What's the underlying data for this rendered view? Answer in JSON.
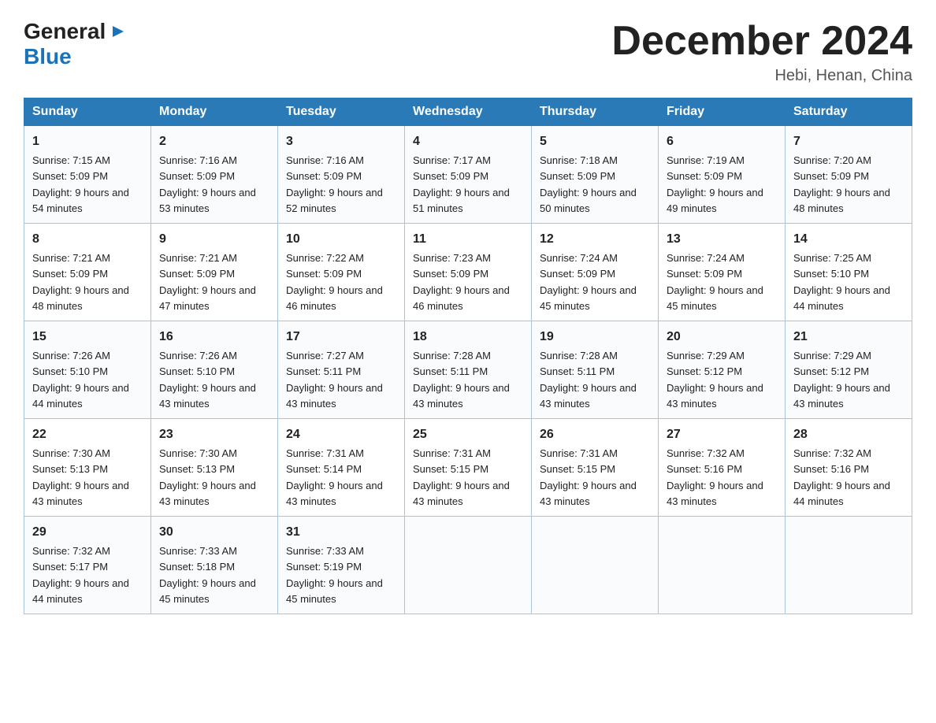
{
  "header": {
    "logo_general": "General",
    "logo_blue": "Blue",
    "month_title": "December 2024",
    "location": "Hebi, Henan, China"
  },
  "weekdays": [
    "Sunday",
    "Monday",
    "Tuesday",
    "Wednesday",
    "Thursday",
    "Friday",
    "Saturday"
  ],
  "weeks": [
    [
      {
        "day": "1",
        "sunrise": "7:15 AM",
        "sunset": "5:09 PM",
        "daylight": "9 hours and 54 minutes."
      },
      {
        "day": "2",
        "sunrise": "7:16 AM",
        "sunset": "5:09 PM",
        "daylight": "9 hours and 53 minutes."
      },
      {
        "day": "3",
        "sunrise": "7:16 AM",
        "sunset": "5:09 PM",
        "daylight": "9 hours and 52 minutes."
      },
      {
        "day": "4",
        "sunrise": "7:17 AM",
        "sunset": "5:09 PM",
        "daylight": "9 hours and 51 minutes."
      },
      {
        "day": "5",
        "sunrise": "7:18 AM",
        "sunset": "5:09 PM",
        "daylight": "9 hours and 50 minutes."
      },
      {
        "day": "6",
        "sunrise": "7:19 AM",
        "sunset": "5:09 PM",
        "daylight": "9 hours and 49 minutes."
      },
      {
        "day": "7",
        "sunrise": "7:20 AM",
        "sunset": "5:09 PM",
        "daylight": "9 hours and 48 minutes."
      }
    ],
    [
      {
        "day": "8",
        "sunrise": "7:21 AM",
        "sunset": "5:09 PM",
        "daylight": "9 hours and 48 minutes."
      },
      {
        "day": "9",
        "sunrise": "7:21 AM",
        "sunset": "5:09 PM",
        "daylight": "9 hours and 47 minutes."
      },
      {
        "day": "10",
        "sunrise": "7:22 AM",
        "sunset": "5:09 PM",
        "daylight": "9 hours and 46 minutes."
      },
      {
        "day": "11",
        "sunrise": "7:23 AM",
        "sunset": "5:09 PM",
        "daylight": "9 hours and 46 minutes."
      },
      {
        "day": "12",
        "sunrise": "7:24 AM",
        "sunset": "5:09 PM",
        "daylight": "9 hours and 45 minutes."
      },
      {
        "day": "13",
        "sunrise": "7:24 AM",
        "sunset": "5:09 PM",
        "daylight": "9 hours and 45 minutes."
      },
      {
        "day": "14",
        "sunrise": "7:25 AM",
        "sunset": "5:10 PM",
        "daylight": "9 hours and 44 minutes."
      }
    ],
    [
      {
        "day": "15",
        "sunrise": "7:26 AM",
        "sunset": "5:10 PM",
        "daylight": "9 hours and 44 minutes."
      },
      {
        "day": "16",
        "sunrise": "7:26 AM",
        "sunset": "5:10 PM",
        "daylight": "9 hours and 43 minutes."
      },
      {
        "day": "17",
        "sunrise": "7:27 AM",
        "sunset": "5:11 PM",
        "daylight": "9 hours and 43 minutes."
      },
      {
        "day": "18",
        "sunrise": "7:28 AM",
        "sunset": "5:11 PM",
        "daylight": "9 hours and 43 minutes."
      },
      {
        "day": "19",
        "sunrise": "7:28 AM",
        "sunset": "5:11 PM",
        "daylight": "9 hours and 43 minutes."
      },
      {
        "day": "20",
        "sunrise": "7:29 AM",
        "sunset": "5:12 PM",
        "daylight": "9 hours and 43 minutes."
      },
      {
        "day": "21",
        "sunrise": "7:29 AM",
        "sunset": "5:12 PM",
        "daylight": "9 hours and 43 minutes."
      }
    ],
    [
      {
        "day": "22",
        "sunrise": "7:30 AM",
        "sunset": "5:13 PM",
        "daylight": "9 hours and 43 minutes."
      },
      {
        "day": "23",
        "sunrise": "7:30 AM",
        "sunset": "5:13 PM",
        "daylight": "9 hours and 43 minutes."
      },
      {
        "day": "24",
        "sunrise": "7:31 AM",
        "sunset": "5:14 PM",
        "daylight": "9 hours and 43 minutes."
      },
      {
        "day": "25",
        "sunrise": "7:31 AM",
        "sunset": "5:15 PM",
        "daylight": "9 hours and 43 minutes."
      },
      {
        "day": "26",
        "sunrise": "7:31 AM",
        "sunset": "5:15 PM",
        "daylight": "9 hours and 43 minutes."
      },
      {
        "day": "27",
        "sunrise": "7:32 AM",
        "sunset": "5:16 PM",
        "daylight": "9 hours and 43 minutes."
      },
      {
        "day": "28",
        "sunrise": "7:32 AM",
        "sunset": "5:16 PM",
        "daylight": "9 hours and 44 minutes."
      }
    ],
    [
      {
        "day": "29",
        "sunrise": "7:32 AM",
        "sunset": "5:17 PM",
        "daylight": "9 hours and 44 minutes."
      },
      {
        "day": "30",
        "sunrise": "7:33 AM",
        "sunset": "5:18 PM",
        "daylight": "9 hours and 45 minutes."
      },
      {
        "day": "31",
        "sunrise": "7:33 AM",
        "sunset": "5:19 PM",
        "daylight": "9 hours and 45 minutes."
      },
      null,
      null,
      null,
      null
    ]
  ]
}
